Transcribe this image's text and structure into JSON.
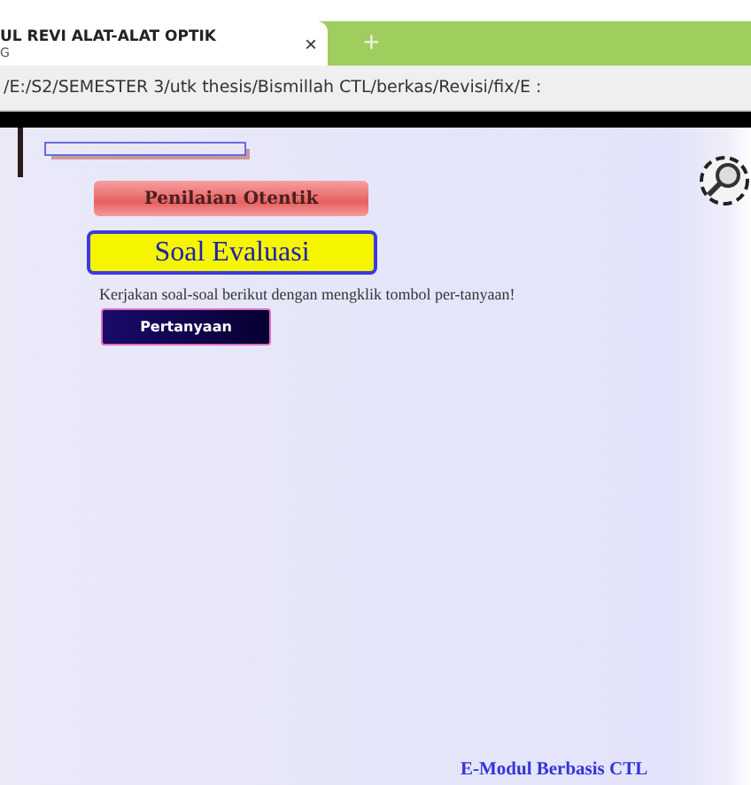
{
  "browser": {
    "tab": {
      "title": "UL REVI ALAT-ALAT OPTIK",
      "title_line_2": "G",
      "close": "×"
    },
    "new_tab": "+",
    "address": "/E:/S2/SEMESTER 3/utk thesis/Bismillah CTL/berkas/Revisi/fix/E :"
  },
  "page": {
    "section_banner": "Penilaian Otentik",
    "heading": "Soal Evaluasi",
    "instruction": "Kerjakan soal-soal berikut dengan mengklik tombol per-tanyaan!",
    "question_button": "Pertanyaan",
    "footer": "E-Modul Berbasis CTL"
  }
}
